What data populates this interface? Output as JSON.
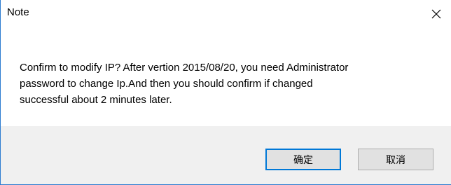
{
  "window": {
    "title": "Note",
    "close_glyph": "close-icon"
  },
  "message": {
    "line1": "Confirm to modify IP?  After vertion 2015/08/20, you need Administrator",
    "line2": "password to change Ip.And then you should confirm if changed",
    "line3": "successful  about 2 minutes later."
  },
  "buttons": {
    "ok_label": "确定",
    "cancel_label": "取消"
  },
  "colors": {
    "accent": "#0078d7",
    "button_bg": "#e1e1e1",
    "footer_bg": "#f0f0f0"
  }
}
